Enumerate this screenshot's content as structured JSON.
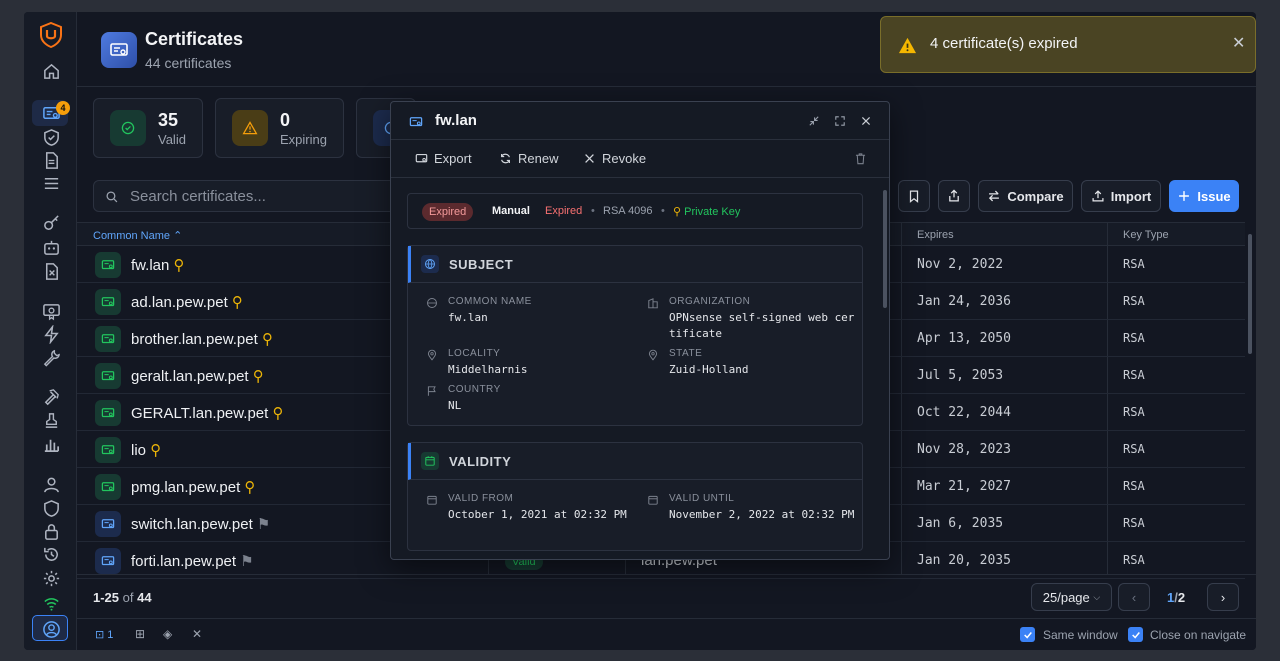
{
  "sidebar": {
    "badge": "4"
  },
  "header": {
    "title": "Certificates",
    "subtitle": "44 certificates"
  },
  "stats": [
    {
      "value": "35",
      "label": "Valid"
    },
    {
      "value": "0",
      "label": "Expiring"
    }
  ],
  "toolbar": {
    "search_placeholder": "Search certificates...",
    "compare": "Compare",
    "import": "Import",
    "issue": "Issue"
  },
  "table": {
    "columns": {
      "common_name": "Common Name",
      "expires": "Expires",
      "key_type": "Key Type"
    },
    "rows": [
      {
        "name": "fw.lan",
        "expires": "Nov 2, 2022",
        "key_type": "RSA",
        "key": "private"
      },
      {
        "name": "ad.lan.pew.pet",
        "expires": "Jan 24, 2036",
        "key_type": "RSA",
        "key": "private"
      },
      {
        "name": "brother.lan.pew.pet",
        "expires": "Apr 13, 2050",
        "key_type": "RSA",
        "key": "private"
      },
      {
        "name": "geralt.lan.pew.pet",
        "expires": "Jul 5, 2053",
        "key_type": "RSA",
        "key": "private"
      },
      {
        "name": "GERALT.lan.pew.pet",
        "expires": "Oct 22, 2044",
        "key_type": "RSA",
        "key": "private"
      },
      {
        "name": "lio",
        "expires": "Nov 28, 2023",
        "key_type": "RSA",
        "key": "private"
      },
      {
        "name": "pmg.lan.pew.pet",
        "expires": "Mar 21, 2027",
        "key_type": "RSA",
        "key": "private"
      },
      {
        "name": "switch.lan.pew.pet",
        "expires": "Jan 6, 2035",
        "key_type": "RSA",
        "key": "none"
      },
      {
        "name": "forti.lan.pew.pet",
        "expires": "Jan 20, 2035",
        "key_type": "RSA",
        "key": "none"
      }
    ],
    "partial_row": {
      "status": "Valid",
      "issuer": "lan.pew.pet"
    }
  },
  "pager": {
    "range": "1-25",
    "of": "of",
    "total": "44",
    "per_page": "25/page",
    "page": "1",
    "pages": "2"
  },
  "bottombar": {
    "windows_count": "1",
    "same_window": "Same window",
    "close_on_navigate": "Close on navigate"
  },
  "toast": {
    "message": "4 certificate(s) expired"
  },
  "modal": {
    "title": "fw.lan",
    "actions": {
      "export": "Export",
      "renew": "Renew",
      "revoke": "Revoke"
    },
    "summary": {
      "status": "Expired",
      "source": "Manual",
      "state": "Expired",
      "algo": "RSA 4096",
      "private_key": "Private Key"
    },
    "subject": {
      "title": "SUBJECT",
      "common_name_label": "COMMON NAME",
      "common_name": "fw.lan",
      "organization_label": "ORGANIZATION",
      "organization": "OPNsense self-signed web certificate",
      "locality_label": "LOCALITY",
      "locality": "Middelharnis",
      "state_label": "STATE",
      "state": "Zuid-Holland",
      "country_label": "COUNTRY",
      "country": "NL"
    },
    "validity": {
      "title": "VALIDITY",
      "from_label": "VALID FROM",
      "from": "October 1, 2021 at 02:32 PM",
      "until_label": "VALID UNTIL",
      "until": "November 2, 2022 at 02:32 PM"
    }
  },
  "colors": {
    "accent": "#3b82f6",
    "valid": "#22c55e",
    "warning": "#f59e0b",
    "expired": "#f87171",
    "private_key": "#eab308"
  }
}
